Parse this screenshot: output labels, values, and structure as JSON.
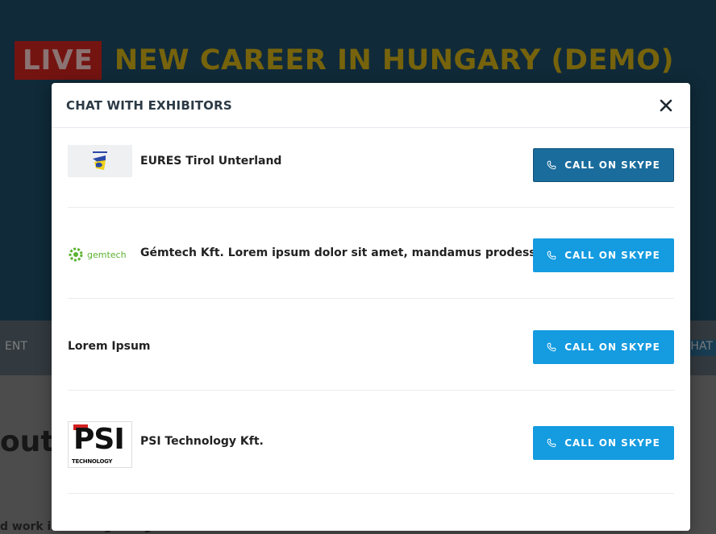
{
  "background": {
    "live_badge": "LIVE",
    "event_title": "NEW CAREER IN HUNGARY (DEMO)",
    "nav_left": "ENT",
    "nav_right": "HAT",
    "heading": "out",
    "footer_text": "d work in the beginning of summer?"
  },
  "modal": {
    "title": "CHAT WITH EXHIBITORS",
    "close_icon": "close-icon",
    "exhibitors": [
      {
        "name": "EURES Tirol Unterland",
        "logo": "eures-logo",
        "button_label": "CALL ON SKYPE",
        "button_state": "active"
      },
      {
        "name": "Gémtech Kft. Lorem ipsum dolor sit amet, mandamus prodesset",
        "logo": "gemtech-logo",
        "logo_text": "gemtech",
        "button_label": "CALL ON SKYPE",
        "button_state": "default"
      },
      {
        "name": "Lorem Ipsum",
        "logo": null,
        "button_label": "CALL ON SKYPE",
        "button_state": "default"
      },
      {
        "name": "PSI Technology Kft.",
        "logo": "psi-logo",
        "logo_text": "PSI",
        "logo_subtext": "TECHNOLOGY",
        "button_label": "CALL ON SKYPE",
        "button_state": "default"
      }
    ]
  },
  "colors": {
    "hero_bg": "#1e4d69",
    "live_red": "#d4261f",
    "title_yellow": "#d8b416",
    "button_blue": "#149be0",
    "button_active": "#1a6c9c"
  },
  "icons": {
    "phone": "phone-icon",
    "close": "close-icon"
  }
}
